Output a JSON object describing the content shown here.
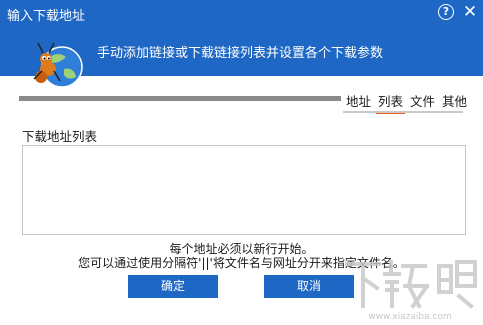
{
  "dialog": {
    "title": "输入下载地址",
    "help_glyph": "?",
    "close_glyph": "✕"
  },
  "banner": {
    "subtitle": "手动添加链接或下载链接列表并设置各个下载参数"
  },
  "tabs": [
    {
      "label": "地址",
      "active": false
    },
    {
      "label": "列表",
      "active": true
    },
    {
      "label": "文件",
      "active": false
    },
    {
      "label": "其他",
      "active": false
    }
  ],
  "list": {
    "label": "下载地址列表",
    "value": ""
  },
  "hints": {
    "line1": "每个地址必须以新行开始。",
    "line2": "您可以通过使用分隔符'||'将文件名与网址分开来指定文件名。"
  },
  "buttons": {
    "ok_label": "确定",
    "cancel_label": "取消"
  },
  "watermark": {
    "text": "下载吧",
    "url": "www.xiazaiba.com"
  },
  "colors": {
    "accent": "#1e67c4",
    "active_tab_underline": "#e8621a"
  }
}
